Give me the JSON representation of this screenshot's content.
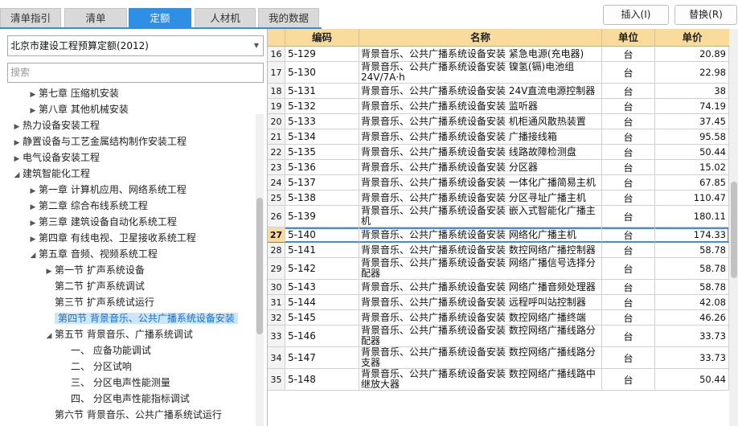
{
  "tabs": [
    {
      "label": "清单指引",
      "active": false
    },
    {
      "label": "清单",
      "active": false
    },
    {
      "label": "定额",
      "active": true
    },
    {
      "label": "人材机",
      "active": false
    },
    {
      "label": "我的数据",
      "active": false
    }
  ],
  "toolbar": {
    "insert_label": "插入(I)",
    "replace_label": "替换(R)"
  },
  "left": {
    "dropdown_value": "北京市建设工程预算定额(2012)",
    "search_placeholder": "搜索"
  },
  "tree": [
    {
      "label": "第七章 压缩机安装",
      "indent": 2,
      "toggle": "collapsed",
      "selected": false
    },
    {
      "label": "第八章 其他机械安装",
      "indent": 2,
      "toggle": "collapsed",
      "selected": false
    },
    {
      "label": "热力设备安装工程",
      "indent": 1,
      "toggle": "collapsed",
      "selected": false
    },
    {
      "label": "静置设备与工艺金属结构制作安装工程",
      "indent": 1,
      "toggle": "collapsed",
      "selected": false
    },
    {
      "label": "电气设备安装工程",
      "indent": 1,
      "toggle": "collapsed",
      "selected": false
    },
    {
      "label": "建筑智能化工程",
      "indent": 1,
      "toggle": "expanded",
      "selected": false
    },
    {
      "label": "第一章 计算机应用、网络系统工程",
      "indent": 2,
      "toggle": "collapsed",
      "selected": false
    },
    {
      "label": "第二章 综合布线系统工程",
      "indent": 2,
      "toggle": "collapsed",
      "selected": false
    },
    {
      "label": "第三章 建筑设备自动化系统工程",
      "indent": 2,
      "toggle": "collapsed",
      "selected": false
    },
    {
      "label": "第四章 有线电视、卫星接收系统工程",
      "indent": 2,
      "toggle": "collapsed",
      "selected": false
    },
    {
      "label": "第五章 音频、视频系统工程",
      "indent": 2,
      "toggle": "expanded",
      "selected": false
    },
    {
      "label": "第一节 扩声系统设备",
      "indent": 3,
      "toggle": "collapsed",
      "selected": false
    },
    {
      "label": "第二节 扩声系统调试",
      "indent": 3,
      "toggle": "none",
      "selected": false
    },
    {
      "label": "第三节 扩声系统试运行",
      "indent": 3,
      "toggle": "none",
      "selected": false
    },
    {
      "label": "第四节 背景音乐、公共广播系统设备安装",
      "indent": 3,
      "toggle": "none",
      "selected": true
    },
    {
      "label": "第五节 背景音乐、广播系统调试",
      "indent": 3,
      "toggle": "expanded",
      "selected": false
    },
    {
      "label": "一、 应备功能调试",
      "indent": 4,
      "toggle": "none",
      "selected": false
    },
    {
      "label": "二、 分区试响",
      "indent": 4,
      "toggle": "none",
      "selected": false
    },
    {
      "label": "三、 分区电声性能测量",
      "indent": 4,
      "toggle": "none",
      "selected": false
    },
    {
      "label": "四、 分区电声性能指标调试",
      "indent": 4,
      "toggle": "none",
      "selected": false
    },
    {
      "label": "第六节 背景音乐、公共广播系统试运行",
      "indent": 3,
      "toggle": "none",
      "selected": false
    }
  ],
  "table": {
    "columns": [
      "编码",
      "名称",
      "单位",
      "单价"
    ],
    "current_row": "27",
    "rows": [
      {
        "no": "16",
        "code": "5-129",
        "name": "背景音乐、公共广播系统设备安装 紧急电源(充电器)",
        "unit": "台",
        "price": "20.89",
        "tall": false
      },
      {
        "no": "17",
        "code": "5-130",
        "name": "背景音乐、公共广播系统设备安装 镍氢(镉)电池组24V/7A·h",
        "unit": "台",
        "price": "22.98",
        "tall": true
      },
      {
        "no": "18",
        "code": "5-131",
        "name": "背景音乐、公共广播系统设备安装 24V直流电源控制器",
        "unit": "台",
        "price": "38",
        "tall": false
      },
      {
        "no": "19",
        "code": "5-132",
        "name": "背景音乐、公共广播系统设备安装 监听器",
        "unit": "台",
        "price": "74.19",
        "tall": false
      },
      {
        "no": "20",
        "code": "5-133",
        "name": "背景音乐、公共广播系统设备安装 机柜通风散热装置",
        "unit": "台",
        "price": "37.45",
        "tall": false
      },
      {
        "no": "21",
        "code": "5-134",
        "name": "背景音乐、公共广播系统设备安装 广播接线箱",
        "unit": "台",
        "price": "95.58",
        "tall": false
      },
      {
        "no": "22",
        "code": "5-135",
        "name": "背景音乐、公共广播系统设备安装 线路故障检测盘",
        "unit": "台",
        "price": "50.44",
        "tall": false
      },
      {
        "no": "23",
        "code": "5-136",
        "name": "背景音乐、公共广播系统设备安装 分区器",
        "unit": "台",
        "price": "15.02",
        "tall": false
      },
      {
        "no": "24",
        "code": "5-137",
        "name": "背景音乐、公共广播系统设备安装 一体化广播简易主机",
        "unit": "台",
        "price": "67.85",
        "tall": false
      },
      {
        "no": "25",
        "code": "5-138",
        "name": "背景音乐、公共广播系统设备安装 分区寻址广播主机",
        "unit": "台",
        "price": "110.47",
        "tall": false
      },
      {
        "no": "26",
        "code": "5-139",
        "name": "背景音乐、公共广播系统设备安装 嵌入式智能化广播主机",
        "unit": "台",
        "price": "180.11",
        "tall": true
      },
      {
        "no": "27",
        "code": "5-140",
        "name": "背景音乐、公共广播系统设备安装 网络化广播主机",
        "unit": "台",
        "price": "174.33",
        "tall": false
      },
      {
        "no": "28",
        "code": "5-141",
        "name": "背景音乐、公共广播系统设备安装 数控网络广播控制器",
        "unit": "台",
        "price": "58.78",
        "tall": false
      },
      {
        "no": "29",
        "code": "5-142",
        "name": "背景音乐、公共广播系统设备安装 网络广播信号选择分配器",
        "unit": "台",
        "price": "58.78",
        "tall": true
      },
      {
        "no": "30",
        "code": "5-143",
        "name": "背景音乐、公共广播系统设备安装 网络广播音频处理器",
        "unit": "台",
        "price": "58.78",
        "tall": false
      },
      {
        "no": "31",
        "code": "5-144",
        "name": "背景音乐、公共广播系统设备安装 远程呼叫站控制器",
        "unit": "台",
        "price": "42.08",
        "tall": false
      },
      {
        "no": "32",
        "code": "5-145",
        "name": "背景音乐、公共广播系统设备安装 数控网络广播终端",
        "unit": "台",
        "price": "46.26",
        "tall": false
      },
      {
        "no": "33",
        "code": "5-146",
        "name": "背景音乐、公共广播系统设备安装 数控网络广播线路分配器",
        "unit": "台",
        "price": "33.73",
        "tall": true
      },
      {
        "no": "34",
        "code": "5-147",
        "name": "背景音乐、公共广播系统设备安装 数控网络广播线路分支器",
        "unit": "台",
        "price": "33.73",
        "tall": true
      },
      {
        "no": "35",
        "code": "5-148",
        "name": "背景音乐、公共广播系统设备安装 数控网络广播线路中继放大器",
        "unit": "台",
        "price": "50.44",
        "tall": true
      }
    ]
  }
}
